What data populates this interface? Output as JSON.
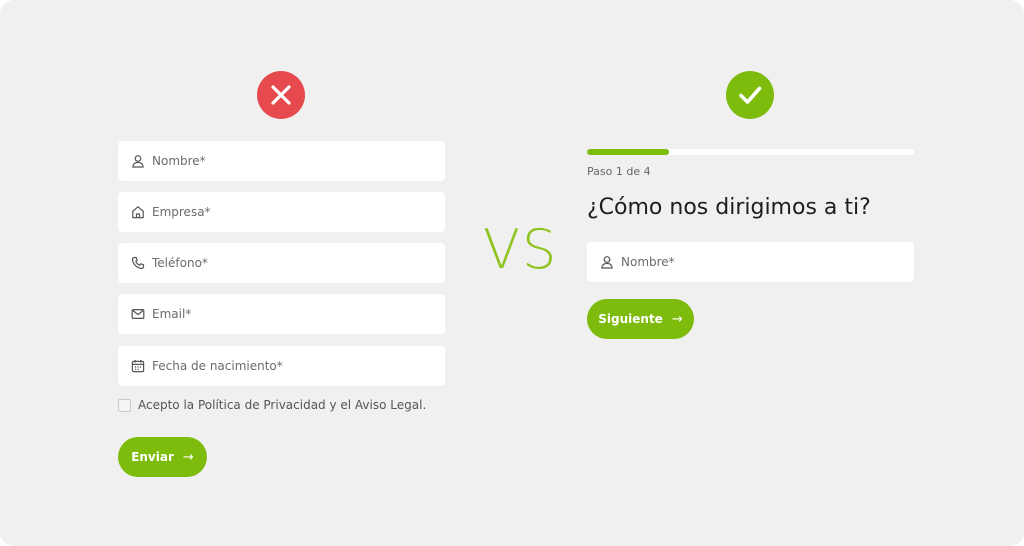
{
  "comparison": {
    "vs_label": "VS"
  },
  "bad_form": {
    "status_icon": "x-icon",
    "status_color": "#e64a4e",
    "fields": [
      {
        "icon": "user-icon",
        "placeholder": "Nombre*"
      },
      {
        "icon": "home-icon",
        "placeholder": "Empresa*"
      },
      {
        "icon": "phone-icon",
        "placeholder": "Teléfono*"
      },
      {
        "icon": "mail-icon",
        "placeholder": "Email*"
      },
      {
        "icon": "calendar-icon",
        "placeholder": "Fecha de nacimiento*"
      }
    ],
    "consent_label": "Acepto la Política de Privacidad y el Aviso Legal.",
    "consent_checked": false,
    "submit_label": "Enviar",
    "submit_icon": "arrow-right-icon"
  },
  "good_form": {
    "status_icon": "check-icon",
    "status_color": "#7dbb0c",
    "progress": {
      "current_step": 1,
      "total_steps": 4,
      "fraction": 0.25
    },
    "step_label": "Paso 1 de 4",
    "question": "¿Cómo nos dirigimos a ti?",
    "field": {
      "icon": "user-icon",
      "placeholder": "Nombre*"
    },
    "next_label": "Siguiente",
    "next_icon": "arrow-right-icon"
  },
  "colors": {
    "accent": "#7dbb0c",
    "error": "#e64a4e",
    "background": "#f0f0f0"
  }
}
